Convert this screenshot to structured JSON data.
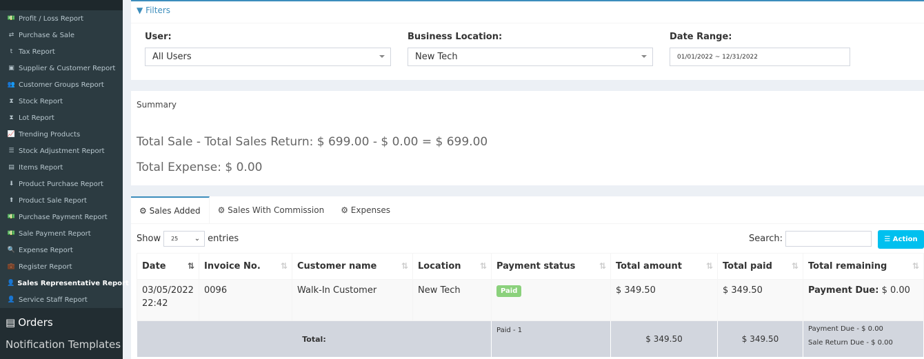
{
  "sidebar": {
    "items": [
      {
        "label": "Profit / Loss Report",
        "icon": "money-icon",
        "g": "💵"
      },
      {
        "label": "Purchase & Sale",
        "icon": "exchange-icon",
        "g": "⇄"
      },
      {
        "label": "Tax Report",
        "icon": "tumblr-icon",
        "g": "t"
      },
      {
        "label": "Supplier & Customer Report",
        "icon": "address-book-icon",
        "g": "▣"
      },
      {
        "label": "Customer Groups Report",
        "icon": "users-icon",
        "g": "👥"
      },
      {
        "label": "Stock Report",
        "icon": "hourglass-icon",
        "g": "⧗"
      },
      {
        "label": "Lot Report",
        "icon": "hourglass-icon",
        "g": "⧗"
      },
      {
        "label": "Trending Products",
        "icon": "line-chart-icon",
        "g": "📈"
      },
      {
        "label": "Stock Adjustment Report",
        "icon": "sliders-icon",
        "g": "☰"
      },
      {
        "label": "Items Report",
        "icon": "tasks-icon",
        "g": "▤"
      },
      {
        "label": "Product Purchase Report",
        "icon": "arrow-circle-down-icon",
        "g": "⬇"
      },
      {
        "label": "Product Sale Report",
        "icon": "arrow-circle-up-icon",
        "g": "⬆"
      },
      {
        "label": "Purchase Payment Report",
        "icon": "money-icon",
        "g": "💵"
      },
      {
        "label": "Sale Payment Report",
        "icon": "money-icon",
        "g": "💵"
      },
      {
        "label": "Expense Report",
        "icon": "search-minus-icon",
        "g": "🔍"
      },
      {
        "label": "Register Report",
        "icon": "briefcase-icon",
        "g": "💼"
      },
      {
        "label": "Sales Representative Report",
        "icon": "user-icon",
        "g": "👤",
        "active": true
      },
      {
        "label": "Service Staff Report",
        "icon": "user-secret-icon",
        "g": "👤"
      }
    ],
    "orders": "Orders",
    "next": "Notification Templates"
  },
  "filters": {
    "title": "Filters",
    "user_label": "User:",
    "user_value": "All Users",
    "location_label": "Business Location:",
    "location_value": "New Tech",
    "date_label": "Date Range:",
    "date_value": "01/01/2022 ~ 12/31/2022"
  },
  "summary": {
    "title": "Summary",
    "line1": "Total Sale - Total Sales Return: $ 699.00 - $ 0.00 = $ 699.00",
    "line2": "Total Expense: $ 0.00"
  },
  "tabs": [
    "Sales Added",
    "Sales With Commission",
    "Expenses"
  ],
  "table": {
    "show": "Show",
    "entries_value": "25",
    "entries": "entries",
    "search_label": "Search:",
    "action": "Action",
    "headers": [
      "Date",
      "Invoice No.",
      "Customer name",
      "Location",
      "Payment status",
      "Total amount",
      "Total paid",
      "Total remaining"
    ],
    "row": {
      "date": "03/05/2022",
      "time": "22:42",
      "invoice": "0096",
      "customer": "Walk-In Customer",
      "location": "New Tech",
      "status": "Paid",
      "amount": "$ 349.50",
      "paid": "$ 349.50",
      "due_label": "Payment Due:",
      "due": "$ 0.00"
    },
    "footer": {
      "label": "Total:",
      "status": "Paid - 1",
      "amount": "$ 349.50",
      "paid": "$ 349.50",
      "due": "Payment Due - $ 0.00",
      "return_due": "Sale Return Due - $ 0.00"
    }
  },
  "colors": {
    "accent": "#3c8dbc",
    "action": "#00c0ef",
    "paid": "#8bd17c"
  }
}
